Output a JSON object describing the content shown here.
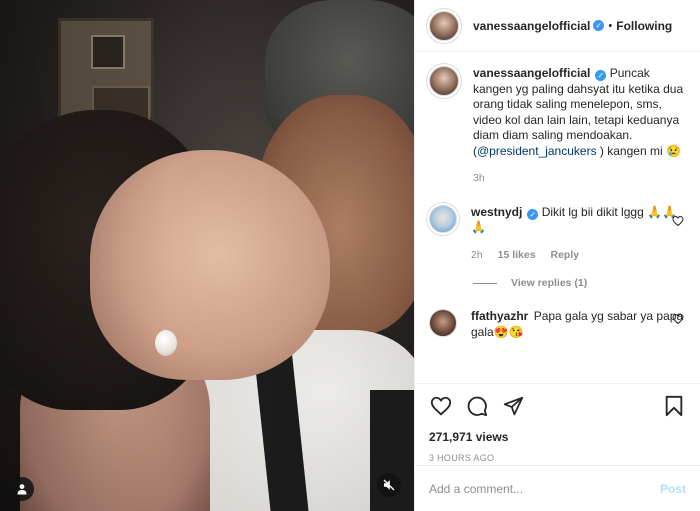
{
  "post": {
    "username": "vanessaangelofficial",
    "follow_status": "Following",
    "separator": "•",
    "verified_mark": "✓",
    "caption_text": "Puncak kangen yg paling dahsyat itu ketika dua orang tidak saling menelepon, sms, video kol dan lain lain, tetapi keduanya diam diam saling mendoakan. (",
    "caption_mention": "@president_jancukers",
    "caption_tail": " ) kangen mi 😢",
    "caption_time": "3h"
  },
  "comments": [
    {
      "username": "westnydj",
      "verified": true,
      "text": "Dikit lg bii dikit lggg 🙏🙏🙏",
      "time": "2h",
      "likes": "15 likes",
      "reply_label": "Reply",
      "view_replies": "View replies (1)"
    },
    {
      "username": "ffathyazhr",
      "verified": false,
      "text": "Papa gala yg sabar ya papa gala😍😘"
    }
  ],
  "stats": {
    "views": "271,971 views",
    "posted": "3 HOURS AGO"
  },
  "composer": {
    "placeholder": "Add a comment...",
    "post_label": "Post"
  },
  "icons": {
    "like": "heart-icon",
    "comment": "comment-icon",
    "share": "share-icon",
    "save": "bookmark-icon",
    "user_tag": "user-icon",
    "mute": "speaker-muted-icon"
  },
  "colors": {
    "verified_blue": "#3897f0",
    "post_button_disabled": "#b2dffc",
    "mention": "#00376b",
    "muted_text": "#8e8e8e"
  }
}
